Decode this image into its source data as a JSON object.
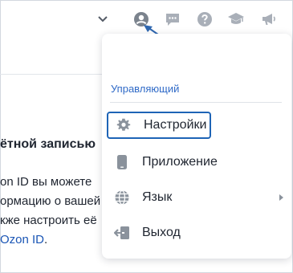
{
  "background": {
    "heading": "ётной записью",
    "line1": "on ID вы можете",
    "line2": "ормацию о вашей",
    "line3": "кже настроить её",
    "line4_link": "Ozon ID",
    "line4_end": "."
  },
  "menu": {
    "role": "Управляющий",
    "items": [
      {
        "label": "Настройки",
        "icon": "gear-icon"
      },
      {
        "label": "Приложение",
        "icon": "phone-icon"
      },
      {
        "label": "Язык",
        "icon": "globe-icon"
      },
      {
        "label": "Выход",
        "icon": "logout-icon"
      }
    ]
  },
  "colors": {
    "accent": "#1e64b6",
    "role_text": "#2f6ac7",
    "icon_gray": "#8a929c",
    "link": "#1a55b5",
    "arrow": "#2f67b0"
  }
}
